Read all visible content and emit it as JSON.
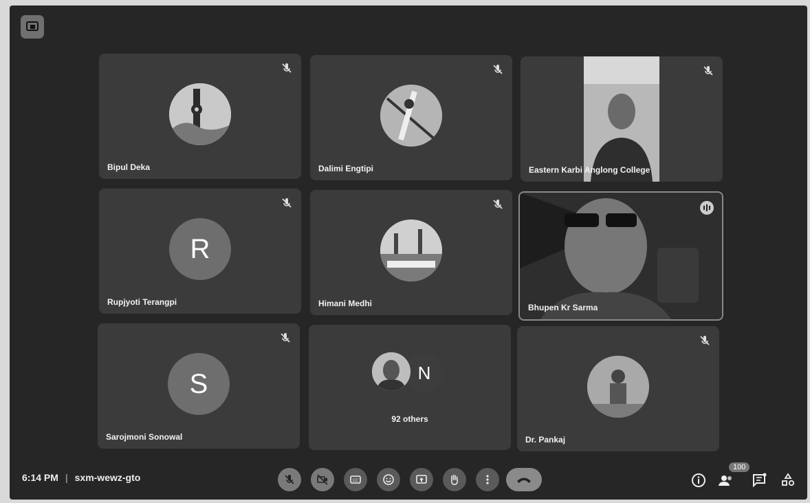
{
  "tiles": [
    {
      "name": "Bipul Deka"
    },
    {
      "name": "Dalimi Engtipi"
    },
    {
      "name": "Eastern Karbi Anglong College"
    },
    {
      "name": "Rupjyoti Terangpi",
      "initial": "R"
    },
    {
      "name": "Himani Medhi"
    },
    {
      "name": "Bhupen Kr Sarma"
    },
    {
      "name": "Sarojmoni Sonowal",
      "initial": "S"
    },
    {
      "initial": "N",
      "others": "92 others"
    },
    {
      "name": "Dr. Pankaj"
    }
  ],
  "bar": {
    "time": "6:14 PM",
    "meeting_code": "sxm-wewz-gto",
    "participants_badge": "100"
  },
  "icons": {
    "mute": "mic-off-icon",
    "cam": "camera-off-icon",
    "cc": "captions-icon",
    "emoji": "emoji-icon",
    "present": "present-icon",
    "hand": "raise-hand-icon",
    "more": "more-vertical-icon",
    "end": "end-call-icon"
  }
}
